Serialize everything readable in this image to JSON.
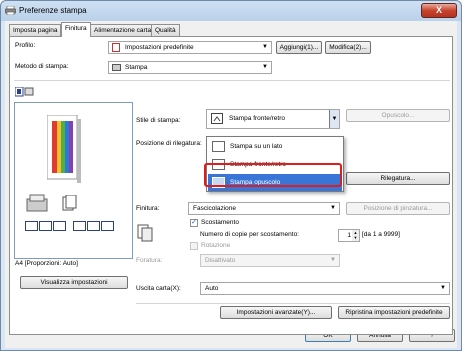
{
  "window": {
    "title": "Preferenze stampa",
    "close_label": "X"
  },
  "tabs": [
    "Imposta pagina",
    "Finitura",
    "Alimentazione carta",
    "Qualità"
  ],
  "profile": {
    "label": "Profilo:",
    "value": "Impostazioni predefinite",
    "add_button": "Aggiungi(1)...",
    "edit_button": "Modifica(2)..."
  },
  "print_method": {
    "label": "Metodo di stampa:",
    "value": "Stampa"
  },
  "print_style": {
    "label": "Stile di stampa:",
    "value": "Stampa fronte/retro",
    "booklet_button": "Opuscolo...",
    "options": [
      "Stampa su un lato",
      "Stampa fronte/retro",
      "Stampa opuscolo"
    ],
    "selected_index": 2
  },
  "binding": {
    "label": "Posizione di rilegatura:",
    "button": "Rilegatura..."
  },
  "finishing": {
    "label": "Finitura:",
    "value": "Fascicolazione",
    "staple_button": "Posizione di pinzatura...",
    "offset_label": "Scostamento",
    "offset_checked": true,
    "copies_label": "Numero di copie per scostamento:",
    "copies_value": "1",
    "copies_range": "[da 1 a 9999]",
    "rotate_label": "Rotazione",
    "rotate_checked": false,
    "punch_label": "Foratura:",
    "punch_value": "Disattivato"
  },
  "output": {
    "label": "Uscita carta(X):",
    "value": "Auto"
  },
  "preview": {
    "paper_label": "A4 [Proporzioni: Auto]",
    "view_button": "Visualizza impostazioni"
  },
  "footer": {
    "advanced_button": "Impostazioni avanzate(Y)...",
    "restore_button": "Ripristina impostazioni predefinite",
    "ok": "OK",
    "cancel": "Annulla",
    "help": "?"
  },
  "colors": {
    "highlight": "#3875d7",
    "callout": "#e01c1c"
  }
}
